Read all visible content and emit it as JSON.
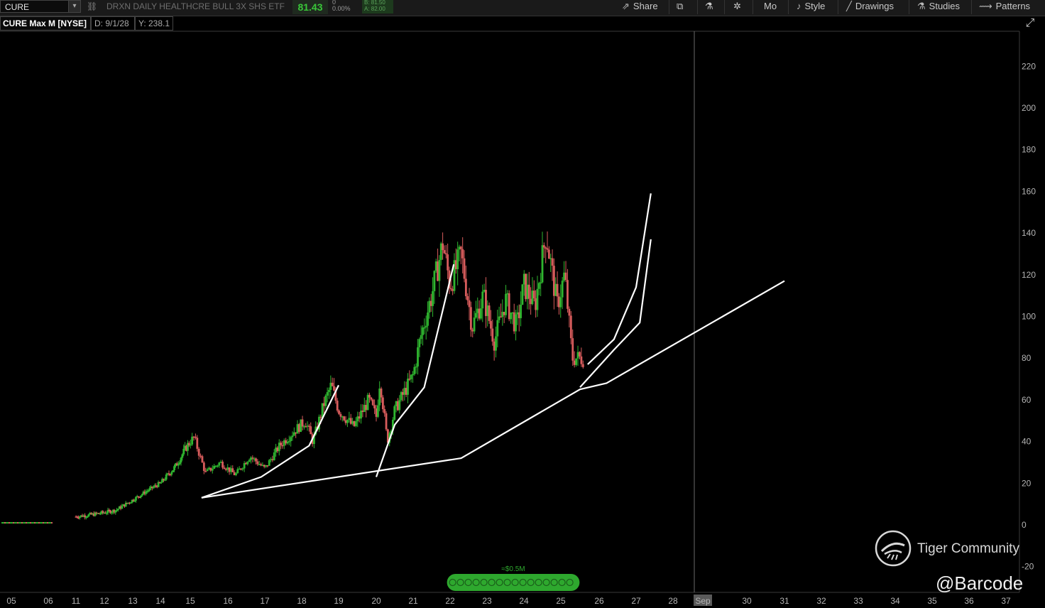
{
  "toolbar": {
    "symbol": "CURE",
    "description": "DRXN DAILY HEALTHCRE BULL 3X SHS ETF",
    "last_price": "81.43",
    "net_change": "0",
    "pct_change": "0.00%",
    "bid": "B: 81.50",
    "ask": "A: 82.00",
    "share_label": "Share",
    "period_label": "Mo",
    "style_label": "Style",
    "drawings_label": "Drawings",
    "studies_label": "Studies",
    "patterns_label": "Patterns"
  },
  "infobar": {
    "title": "CURE Max M [NYSE]",
    "date": "D: 9/1/28",
    "value": "Y: 238.1"
  },
  "watermark": {
    "brand": "Tiger Community",
    "handle": "@Barcode"
  },
  "colors": {
    "up": "#2fb52f",
    "down": "#d85c5c",
    "trendline": "#ffffff",
    "volume": "#2ea82e"
  },
  "chart_data": {
    "type": "candlestick",
    "ylim": [
      -20,
      240
    ],
    "y_ticks": [
      220,
      200,
      180,
      160,
      140,
      120,
      100,
      80,
      60,
      40,
      20,
      0,
      -20
    ],
    "x_ticks": [
      "05",
      "06",
      "11",
      "12",
      "13",
      "14",
      "15",
      "16",
      "17",
      "18",
      "19",
      "20",
      "21",
      "22",
      "23",
      "24",
      "25",
      "26",
      "27",
      "28",
      "Sep",
      "30",
      "31",
      "32",
      "33",
      "34",
      "35",
      "36",
      "37"
    ],
    "x_tick_years": [
      2005,
      2006,
      2011,
      2012,
      2013,
      2014,
      2015,
      2016,
      2017,
      2018,
      2019,
      2020,
      2021,
      2022,
      2023,
      2024,
      2025,
      2026,
      2027,
      2028,
      2029,
      2030,
      2031,
      2032,
      2033,
      2034,
      2035,
      2036,
      2037
    ],
    "highlighted_tick": "Sep",
    "cursor_x": "Sep",
    "price_path": [
      [
        2005.0,
        1
      ],
      [
        2006.1,
        0
      ],
      [
        2011.0,
        4
      ],
      [
        2011.6,
        5
      ],
      [
        2012.4,
        7
      ],
      [
        2013.0,
        12
      ],
      [
        2013.6,
        17
      ],
      [
        2014.0,
        20
      ],
      [
        2014.5,
        28
      ],
      [
        2014.9,
        38
      ],
      [
        2015.1,
        42
      ],
      [
        2015.4,
        25
      ],
      [
        2015.8,
        30
      ],
      [
        2016.2,
        24
      ],
      [
        2016.6,
        33
      ],
      [
        2017.0,
        27
      ],
      [
        2017.4,
        38
      ],
      [
        2017.8,
        45
      ],
      [
        2018.1,
        50
      ],
      [
        2018.3,
        40
      ],
      [
        2018.6,
        58
      ],
      [
        2018.8,
        67
      ],
      [
        2019.0,
        55
      ],
      [
        2019.4,
        47
      ],
      [
        2019.8,
        60
      ],
      [
        2020.0,
        52
      ],
      [
        2020.1,
        70
      ],
      [
        2020.3,
        40
      ],
      [
        2020.5,
        55
      ],
      [
        2020.8,
        65
      ],
      [
        2021.0,
        72
      ],
      [
        2021.2,
        90
      ],
      [
        2021.5,
        110
      ],
      [
        2021.8,
        135
      ],
      [
        2022.0,
        115
      ],
      [
        2022.3,
        130
      ],
      [
        2022.6,
        95
      ],
      [
        2022.9,
        110
      ],
      [
        2023.2,
        88
      ],
      [
        2023.5,
        108
      ],
      [
        2023.8,
        95
      ],
      [
        2024.0,
        115
      ],
      [
        2024.3,
        105
      ],
      [
        2024.6,
        140
      ],
      [
        2024.9,
        105
      ],
      [
        2025.1,
        120
      ],
      [
        2025.3,
        80
      ],
      [
        2025.6,
        80
      ]
    ],
    "trendlines": [
      [
        [
          2015.3,
          13
        ],
        [
          2022.3,
          32
        ],
        [
          2025.5,
          65
        ],
        [
          2026.2,
          68
        ],
        [
          2031.0,
          117
        ]
      ],
      [
        [
          2015.3,
          13
        ],
        [
          2016.9,
          23
        ],
        [
          2018.2,
          38
        ],
        [
          2019.0,
          67
        ]
      ],
      [
        [
          2020.0,
          23
        ],
        [
          2020.5,
          48
        ],
        [
          2021.3,
          66
        ],
        [
          2022.1,
          125
        ]
      ],
      [
        [
          2025.5,
          66
        ],
        [
          2026.4,
          84
        ],
        [
          2027.1,
          97
        ],
        [
          2027.4,
          137
        ]
      ],
      [
        [
          2025.7,
          77
        ],
        [
          2026.4,
          89
        ],
        [
          2027.0,
          114
        ],
        [
          2027.4,
          159
        ]
      ]
    ],
    "volume_label": "≈$0.5M volume bars",
    "volume_range": [
      2021.8,
      2025.6
    ]
  }
}
